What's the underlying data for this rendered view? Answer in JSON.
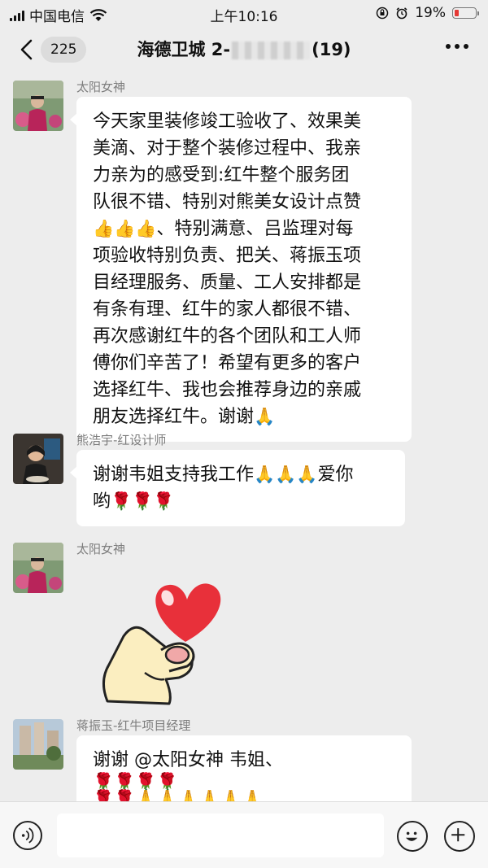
{
  "status_bar": {
    "carrier": "中国电信",
    "time": "上午10:16",
    "battery": "19%",
    "battery_level": 0.19
  },
  "header": {
    "back_count": "225",
    "title_prefix": "海德卫城 2-",
    "title_suffix": "(19)"
  },
  "messages": [
    {
      "sender": "太阳女神",
      "parts": [
        "今天家里装修竣工验收了、效果美\n美滴、对于整个装修过程中、我亲\n力亲为的感受到:红牛整个服务团\n队很不错、特别对熊美女设计点赞\n",
        "👍👍👍",
        "、特别满意、吕监理对每\n项验收特别负责、把关、蒋振玉项\n目经理服务、质量、工人安排都是\n有条有理、红牛的家人都很不错、\n再次感谢红牛的各个团队和工人师\n傅你们辛苦了！希望有更多的客户\n选择红牛、我也会推荐身边的亲戚\n朋友选择红牛。谢谢",
        "🙏"
      ]
    },
    {
      "sender": "熊浩宇-红设计师",
      "parts": [
        "谢谢韦姐支持我工作",
        "🙏🙏🙏",
        "爱你\n哟",
        "🌹🌹🌹"
      ]
    },
    {
      "sender": "太阳女神",
      "sticker": "finger-heart-sticker"
    },
    {
      "sender": "蒋振玉-红牛项目经理",
      "parts": [
        "谢谢 @太阳女神 韦姐、",
        "🌹🌹🌹🌹\n🌹🌹🙏🙏🙏🙏🙏🙏"
      ]
    }
  ],
  "input_bar": {
    "placeholder": ""
  },
  "colors": {
    "background": "#ededed",
    "bubble": "#ffffff",
    "sender_name": "#7d7d7d",
    "heart": "#e8303a"
  },
  "icons": [
    "back-icon",
    "more-icon",
    "voice-icon",
    "emoji-icon",
    "plus-icon",
    "wifi-icon",
    "signal-icon",
    "battery-icon",
    "alarm-icon",
    "lock-rotation-icon"
  ]
}
